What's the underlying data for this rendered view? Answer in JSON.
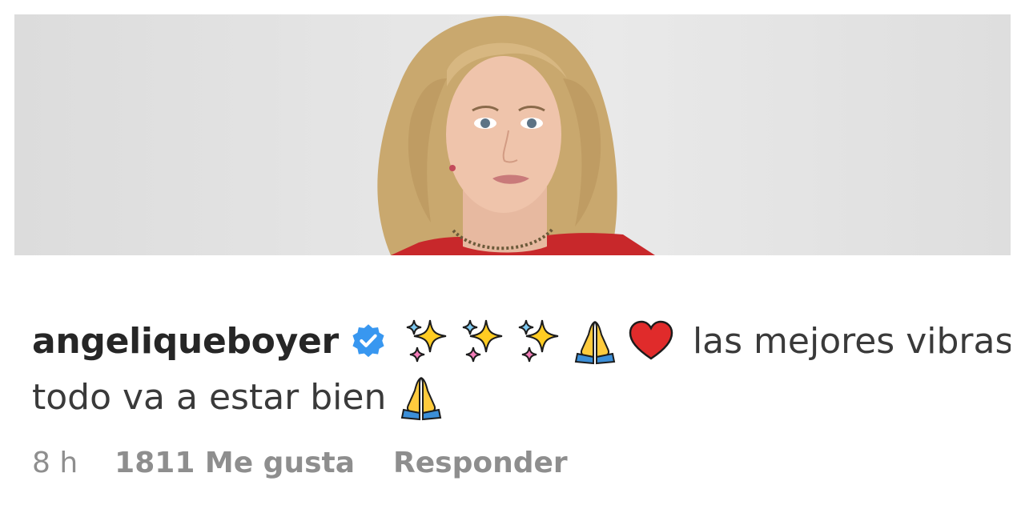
{
  "comment": {
    "username": "angeliqueboyer",
    "verified": true,
    "emojis_line1": [
      "sparkles",
      "sparkles",
      "sparkles",
      "folded-hands",
      "red-heart"
    ],
    "text_line1": "las mejores vibras!",
    "text_line2": "todo va a estar bien",
    "emojis_line2": [
      "folded-hands"
    ]
  },
  "meta": {
    "time": "8 h",
    "likes": "1811 Me gusta",
    "reply": "Responder"
  },
  "colors": {
    "text": "#262626",
    "muted": "#8e8e8e",
    "verified_blue": "#3897f0",
    "dress_red": "#c8282b"
  }
}
